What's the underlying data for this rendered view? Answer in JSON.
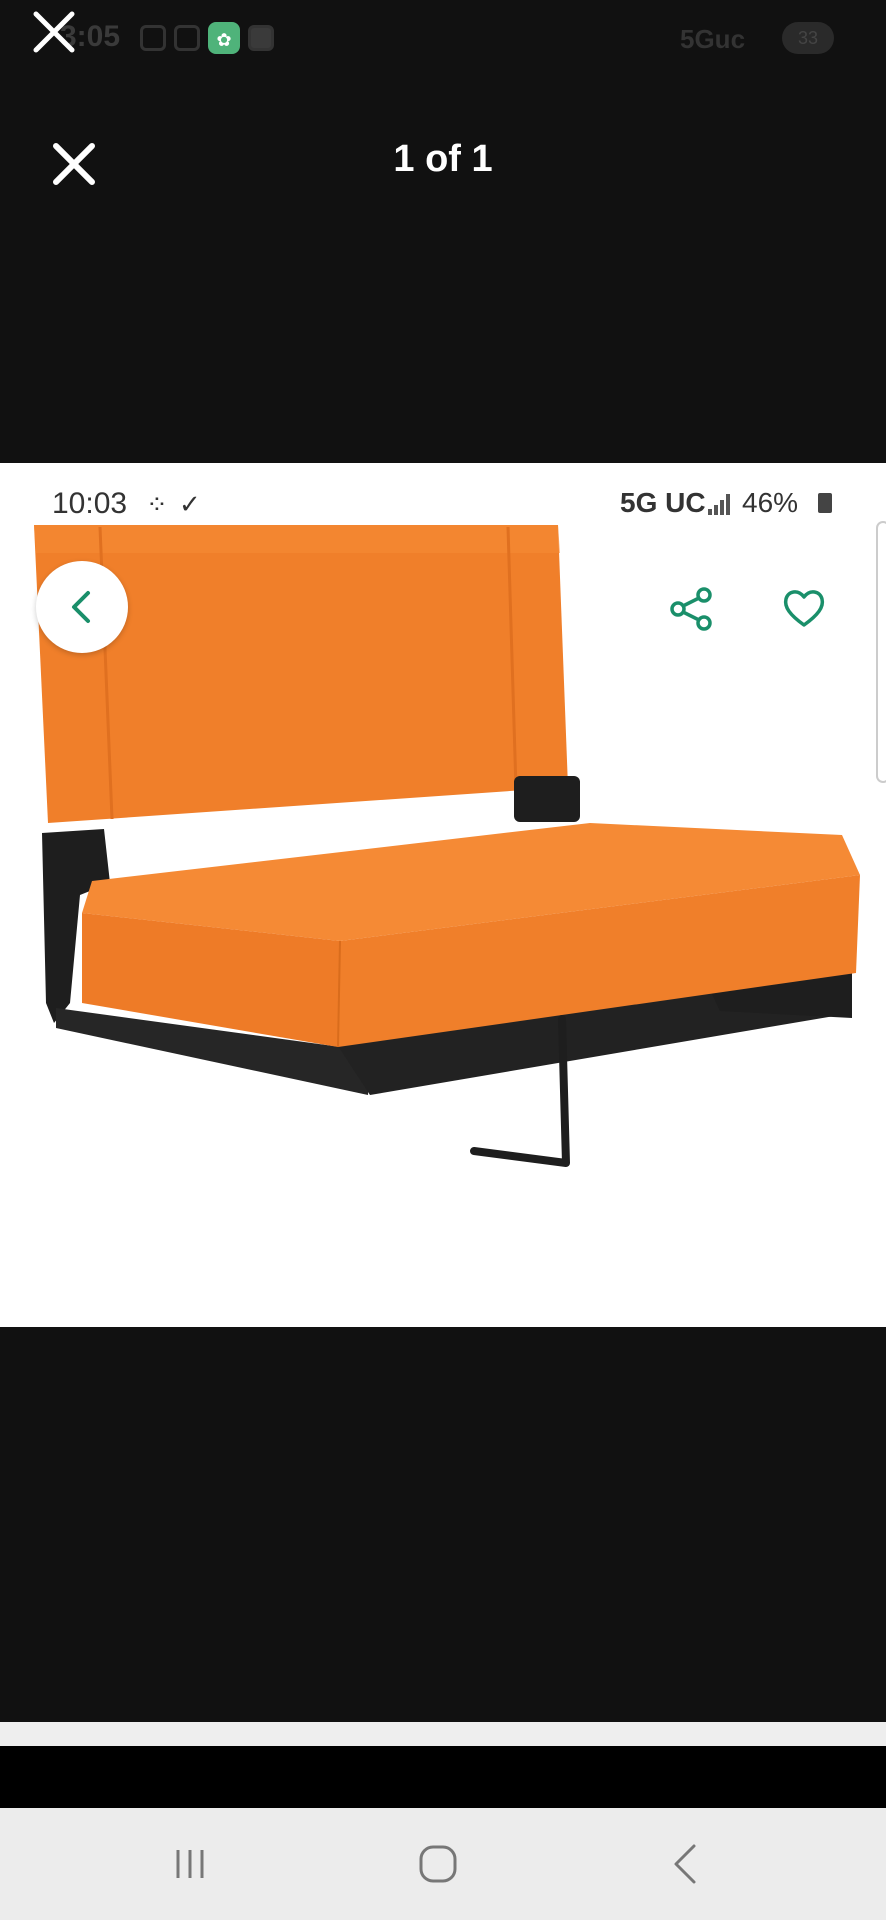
{
  "outer_status": {
    "time": "3:05",
    "network": "5Guc",
    "battery": "33",
    "app_badge": "✿"
  },
  "viewer": {
    "counter": "1 of 1"
  },
  "embedded_screenshot": {
    "time": "10:03",
    "status_icons": "⁘ ✓",
    "network": "5G UC",
    "battery": "46%"
  },
  "colors": {
    "seat_orange": "#f07f2a",
    "frame_black": "#1e1e1e",
    "accent_green": "#1a8f6a"
  },
  "icons": {
    "outer_close": "close-icon",
    "viewer_close": "close-icon",
    "back": "chevron-left-icon",
    "share": "share-icon",
    "favorite": "heart-icon",
    "nav_recents": "recents-icon",
    "nav_home": "home-icon",
    "nav_back": "back-icon"
  }
}
